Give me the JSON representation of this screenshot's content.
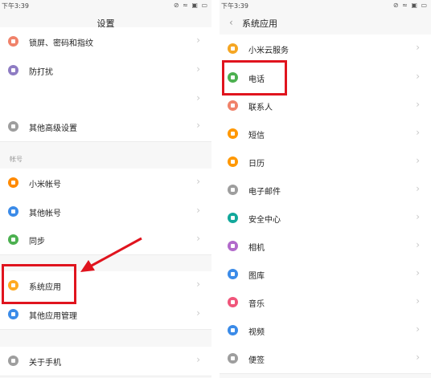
{
  "status_bar": {
    "time": "下午3:39",
    "icons": "⊘ ≈ ▣ ▭"
  },
  "left": {
    "title": "设置",
    "section_account": "帐号",
    "items": [
      {
        "label": "锁屏、密码和指纹",
        "color": "#f0826a"
      },
      {
        "label": "防打扰",
        "color": "#8e7cc3"
      },
      {
        "label": "",
        "color": ""
      },
      {
        "label": "其他高级设置",
        "color": "#9e9e9e"
      },
      {
        "label": "小米帐号",
        "color": "#ff8a00"
      },
      {
        "label": "其他帐号",
        "color": "#3b8be8"
      },
      {
        "label": "同步",
        "color": "#4cb050"
      },
      {
        "label": "系统应用",
        "color": "#ffaa22"
      },
      {
        "label": "其他应用管理",
        "color": "#3b8be8"
      },
      {
        "label": "关于手机",
        "color": "#9e9e9e"
      }
    ]
  },
  "right": {
    "title": "系统应用",
    "items": [
      {
        "label": "小米云服务",
        "color": "#f5a623"
      },
      {
        "label": "电话",
        "color": "#4cb050"
      },
      {
        "label": "联系人",
        "color": "#f0826a"
      },
      {
        "label": "短信",
        "color": "#ff9800"
      },
      {
        "label": "日历",
        "color": "#ff9800"
      },
      {
        "label": "电子邮件",
        "color": "#9e9e9e"
      },
      {
        "label": "安全中心",
        "color": "#12a89b"
      },
      {
        "label": "相机",
        "color": "#b26acb"
      },
      {
        "label": "图库",
        "color": "#3b8be8"
      },
      {
        "label": "音乐",
        "color": "#f0557a"
      },
      {
        "label": "视频",
        "color": "#3b8be8"
      },
      {
        "label": "便签",
        "color": "#9e9e9e"
      }
    ]
  },
  "highlight_color": "#e0141e"
}
